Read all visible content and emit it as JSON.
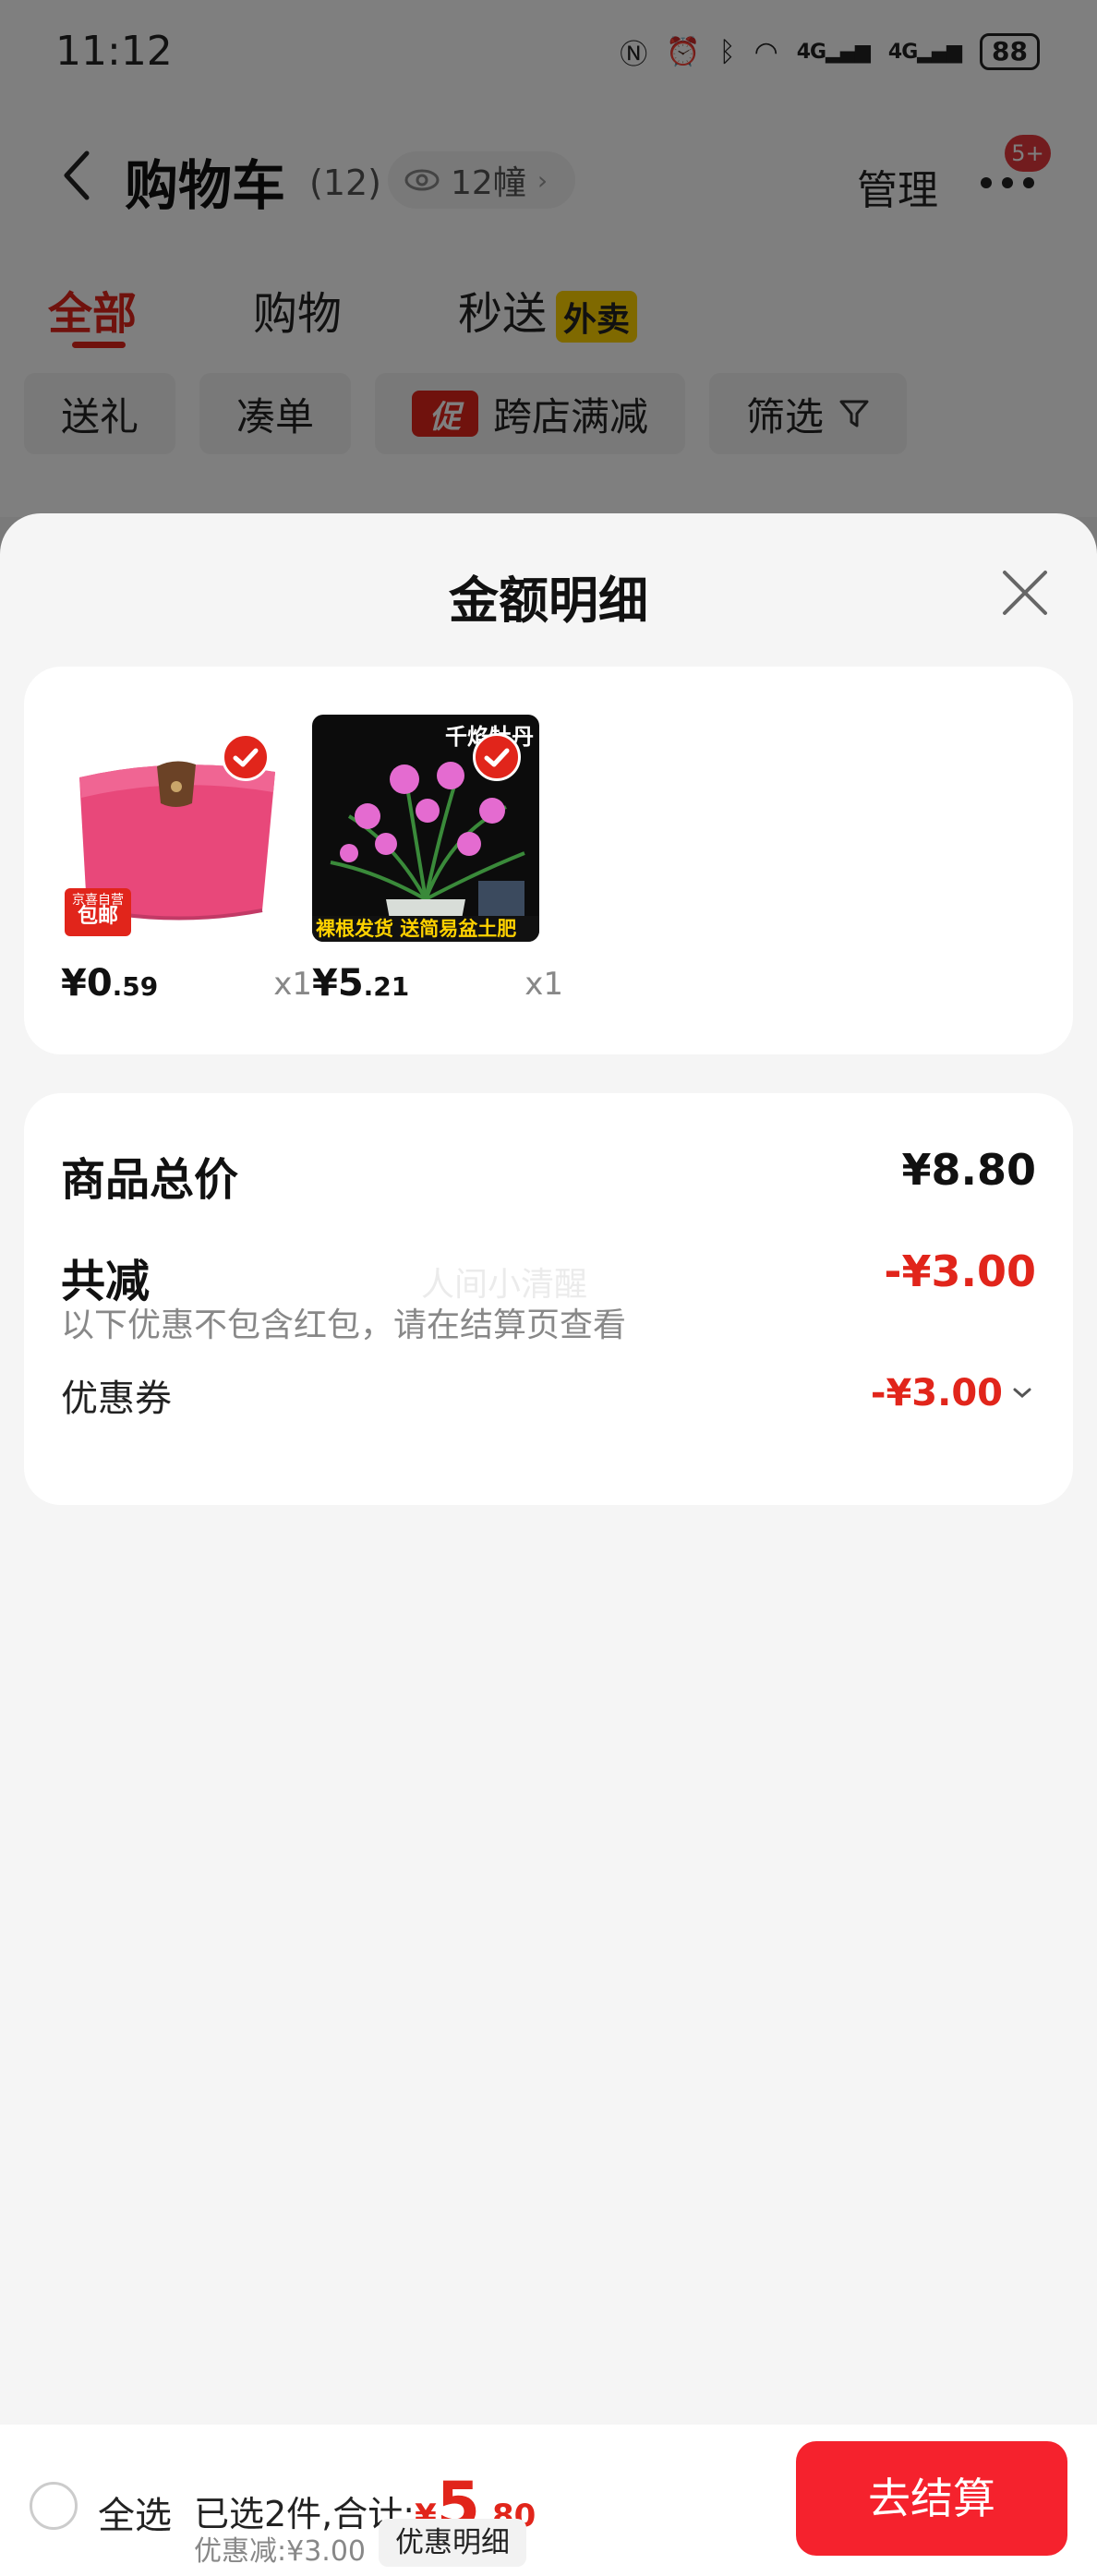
{
  "status_bar": {
    "time": "11:12",
    "signal_1": "4G",
    "signal_2": "4G",
    "battery": "88"
  },
  "nav": {
    "title": "购物车",
    "count": "(12)",
    "views": "12幢",
    "manage_label": "管理",
    "more_badge": "5+"
  },
  "tabs": [
    {
      "label": "全部",
      "active": true
    },
    {
      "label": "购物",
      "active": false
    },
    {
      "label": "秒送",
      "active": false,
      "badge": "外卖"
    }
  ],
  "filter_chips": [
    {
      "label": "送礼"
    },
    {
      "label": "凑单"
    },
    {
      "label": "跨店满减",
      "tag": "促"
    },
    {
      "label": "筛选"
    }
  ],
  "sheet": {
    "title": "金额明细",
    "items": [
      {
        "price_int": "¥0",
        "price_dec": ".59",
        "qty": "x1",
        "badge_top": "京喜自营",
        "badge_bottom": "包邮"
      },
      {
        "price_int": "¥5",
        "price_dec": ".21",
        "qty": "x1",
        "top_label": "千焰牡丹",
        "bottom_label": "裸根发货 送简易盆土肥"
      }
    ],
    "summary": {
      "total_label": "商品总价",
      "total_value": "¥8.80",
      "reduce_label": "共减",
      "reduce_value": "-¥3.00",
      "note": "以下优惠不包含红包，请在结算页查看",
      "coupon_label": "优惠券",
      "coupon_value": "-¥3.00",
      "watermark": "人间小清醒"
    }
  },
  "bottom_bar": {
    "select_all": "全选",
    "selected_text": "已选2件,合计:",
    "total_currency": "¥",
    "total_int": "5",
    "total_dec": ".80",
    "discount_text": "优惠减:¥3.00",
    "discount_detail": "优惠明细",
    "checkout": "去结算"
  },
  "colors": {
    "accent_red": "#e1251b",
    "checkout_red": "#f5222d",
    "waimai_yellow": "#ffd200"
  }
}
